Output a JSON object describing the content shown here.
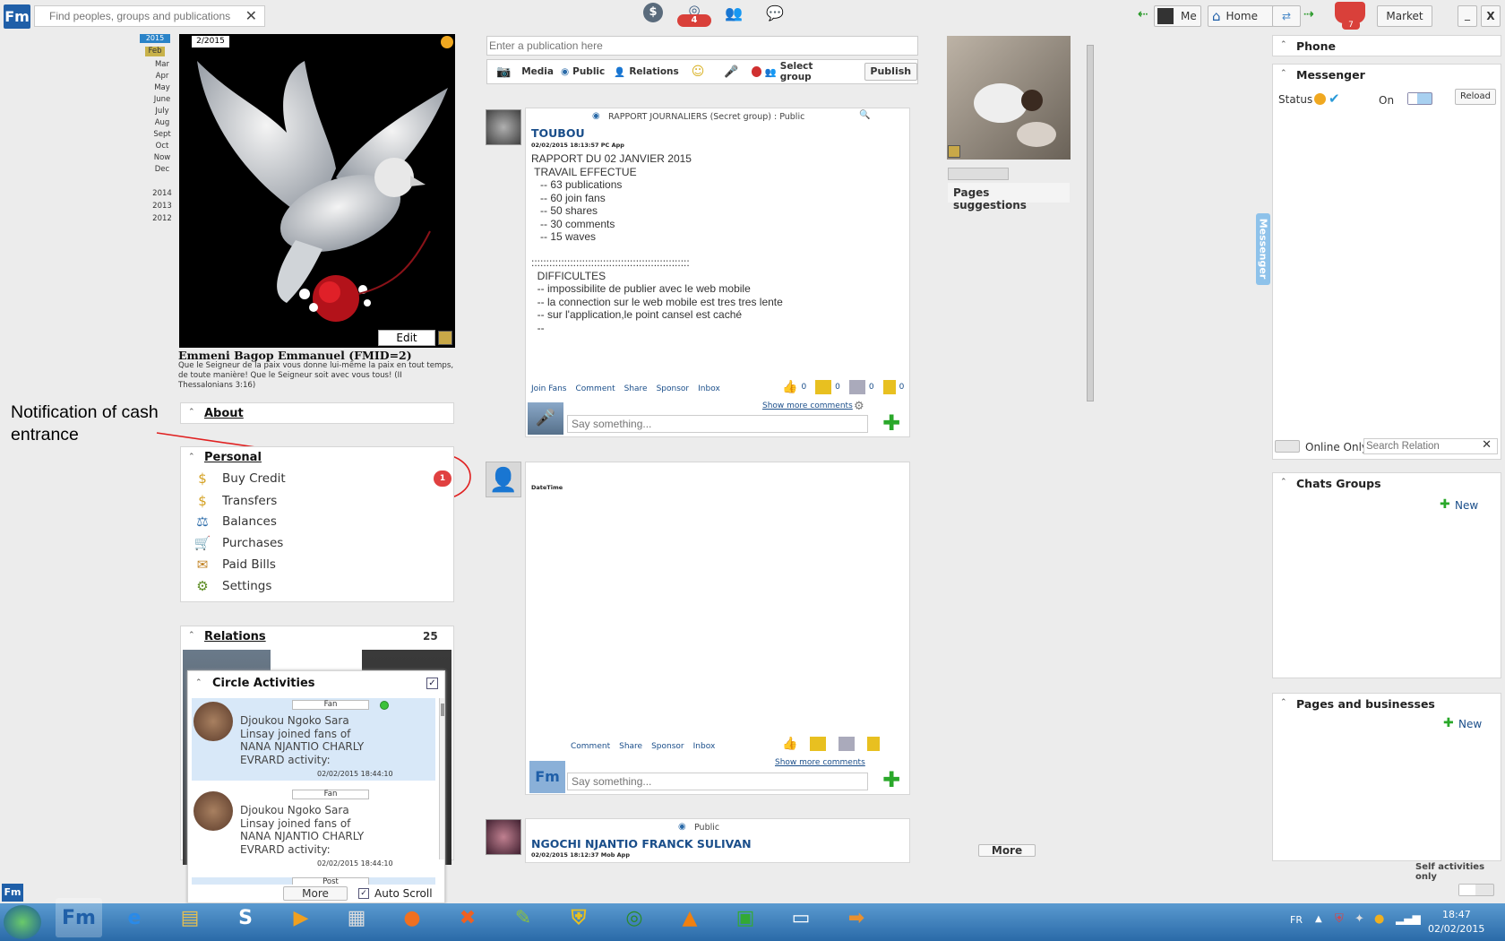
{
  "header": {
    "logo": "Fm",
    "search_placeholder": "Find peoples, groups and publications",
    "notif_count": "4",
    "nav_me": "Me",
    "nav_home": "Home",
    "nav_market": "Market",
    "cart_count": "7",
    "min_label": "_",
    "close_label": "X"
  },
  "timeline": {
    "current_year": "2015",
    "months": [
      "Feb",
      "Mar",
      "Apr",
      "May",
      "June",
      "July",
      "Aug",
      "Sept",
      "Oct",
      "Now",
      "Dec"
    ],
    "years": [
      "2014",
      "2013",
      "2012"
    ]
  },
  "profile": {
    "date_label": "2/2015",
    "edit_label": "Edit",
    "name": "Emmeni Bagop Emmanuel (FMID=2)",
    "quote": "Que le Seigneur de la paix vous donne lui-même la paix en tout temps, de toute manière! Que le Seigneur soit avec vous tous! (II Thessalonians 3:16)"
  },
  "annotation": {
    "text": "Notification of cash entrance"
  },
  "about": {
    "title": "About"
  },
  "personal": {
    "title": "Personal",
    "badge": "1",
    "items": [
      "Buy Credit",
      "Transfers",
      "Balances",
      "Purchases",
      "Paid Bills",
      "Settings"
    ]
  },
  "relations": {
    "title": "Relations",
    "count": "25"
  },
  "circle": {
    "title": "Circle Activities",
    "items": [
      {
        "tag": "Fan",
        "text": "Djoukou Ngoko Sara Linsay joined fans of  NANA NJANTIO CHARLY EVRARD activity:",
        "time": "02/02/2015 18:44:10"
      },
      {
        "tag": "Fan",
        "text": "Djoukou Ngoko Sara Linsay joined fans of  NANA NJANTIO CHARLY EVRARD activity:",
        "time": "02/02/2015 18:44:10"
      },
      {
        "tag": "Post"
      }
    ],
    "more": "More",
    "autoscroll": "Auto Scroll"
  },
  "publish": {
    "placeholder": "Enter a publication here",
    "media": "Media",
    "public": "Public",
    "relations": "Relations",
    "select_group": "Select group",
    "publish_btn": "Publish"
  },
  "post1": {
    "group": "RAPPORT JOURNALIERS (Secret group) : Public",
    "author": "TOUBOU",
    "meta": "02/02/2015 18:13:57  PC App",
    "lines": [
      "RAPPORT DU 02 JANVIER 2015",
      " TRAVAIL EFFECTUE",
      "   -- 63 publications",
      "   -- 60 join fans",
      "   -- 50 shares",
      "   -- 30 comments",
      "   -- 15 waves",
      "",
      ":::::::::::::::::::::::::::::::::::::::::::::::::::::",
      "  DIFFICULTES",
      "  -- impossibilite de publier avec le web mobile",
      "  -- la connection sur le web mobile est tres tres lente",
      "  -- sur l'application,le point cansel est caché",
      "  --"
    ],
    "actions": [
      "Join Fans",
      "Comment",
      "Share",
      "Sponsor",
      "Inbox"
    ],
    "counts": [
      "0",
      "0",
      "0",
      "0"
    ],
    "show_more": "Show more comments",
    "say": "Say something..."
  },
  "post2": {
    "meta": "DateTime",
    "actions": [
      "Comment",
      "Share",
      "Sponsor",
      "Inbox"
    ],
    "show_more": "Show more comments",
    "say": "Say something..."
  },
  "post3": {
    "group": "Public",
    "author": "NGOCHI NJANTIO FRANCK SULIVAN",
    "meta": "02/02/2015 18:12:37  Mob App"
  },
  "right_col": {
    "pages_suggestions": "Pages suggestions",
    "more": "More"
  },
  "messenger_tab": "Messenger",
  "chat": {
    "phone": "Phone",
    "messenger": "Messenger",
    "status": "Status",
    "on": "On",
    "reload": "Reload",
    "online_only": "Online Only",
    "search_relation": "Search Relation",
    "chats_groups": "Chats Groups",
    "new1": "New",
    "pages_businesses": "Pages and businesses",
    "new2": "New",
    "self_activities": "Self activities only"
  },
  "taskbar": {
    "lang": "FR",
    "time": "18:47",
    "date": "02/02/2015"
  }
}
